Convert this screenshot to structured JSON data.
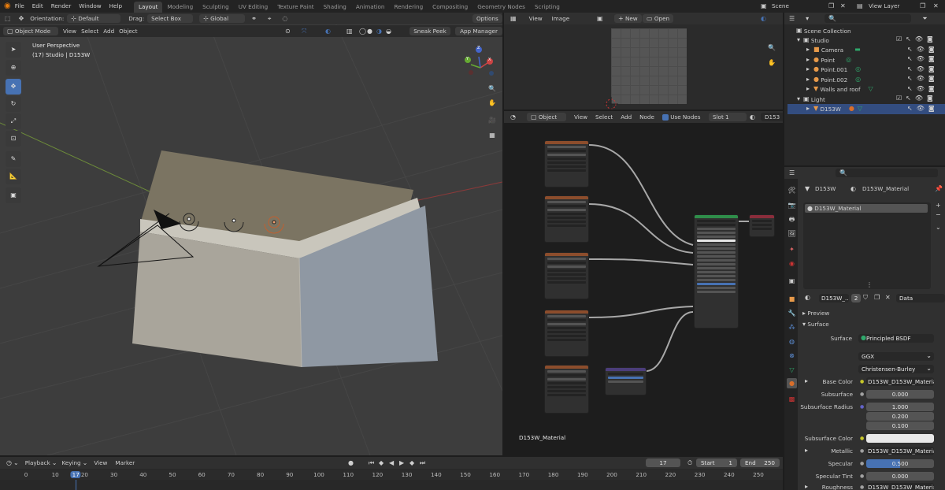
{
  "topbar": {
    "menus": [
      "File",
      "Edit",
      "Render",
      "Window",
      "Help"
    ],
    "workspaces": [
      "Layout",
      "Modeling",
      "Sculpting",
      "UV Editing",
      "Texture Paint",
      "Shading",
      "Animation",
      "Rendering",
      "Compositing",
      "Geometry Nodes",
      "Scripting"
    ],
    "active_workspace": "Layout",
    "scene": "Scene",
    "view_layer": "View Layer"
  },
  "viewport": {
    "toolheader": {
      "orientation_label": "Orientation:",
      "orientation_value": "Default",
      "drag_label": "Drag:",
      "drag_value": "Select Box",
      "transform_value": "Global",
      "options": "Options"
    },
    "header": {
      "mode": "Object Mode",
      "menus": [
        "View",
        "Select",
        "Add",
        "Object"
      ],
      "sneak_peek": "Sneak Peek",
      "app_manager": "App Manager"
    },
    "perspective": "User Perspective",
    "info": "(17) Studio | D153W",
    "gizmo": {
      "x": "X",
      "y": "Y",
      "z": "Z"
    }
  },
  "image_editor": {
    "menus": [
      "View",
      "Image"
    ],
    "new": "New",
    "open": "Open"
  },
  "node_editor": {
    "object": "Object",
    "menus": [
      "View",
      "Select",
      "Add",
      "Node"
    ],
    "use_nodes": "Use Nodes",
    "slot": "Slot 1",
    "material_short": "D153",
    "material_label": "D153W_Material"
  },
  "outliner": {
    "search_placeholder": "",
    "rows": [
      {
        "label": "Scene Collection",
        "indent": 0
      },
      {
        "label": "Studio",
        "indent": 1
      },
      {
        "label": "Camera",
        "indent": 2
      },
      {
        "label": "Point",
        "indent": 2
      },
      {
        "label": "Point.001",
        "indent": 2
      },
      {
        "label": "Point.002",
        "indent": 2
      },
      {
        "label": "Walls and roof",
        "indent": 2
      },
      {
        "label": "Light",
        "indent": 1
      },
      {
        "label": "D153W",
        "indent": 2
      }
    ]
  },
  "properties": {
    "object_name": "D153W",
    "material_name": "D153W_Material",
    "slot_item": "D153W_Material",
    "datablock": "D153W_...",
    "users": "2",
    "link": "Data",
    "panels": {
      "preview": "Preview",
      "surface": "Surface"
    },
    "surface_label": "Surface",
    "surface_value": "Principled BSDF",
    "distribution": "GGX",
    "subsurface_method": "Christensen-Burley",
    "fields": [
      {
        "label": "Base Color",
        "value": "D153W_D153W_Materia..."
      },
      {
        "label": "Subsurface",
        "value": "0.000"
      },
      {
        "label": "Subsurface Radius",
        "value": "1.000"
      },
      {
        "label": "",
        "value": "0.200"
      },
      {
        "label": "",
        "value": "0.100"
      },
      {
        "label": "Subsurface Color",
        "value": ""
      },
      {
        "label": "Metallic",
        "value": "D153W_D153W_Materia..."
      },
      {
        "label": "Specular",
        "value": "0.500"
      },
      {
        "label": "Specular Tint",
        "value": "0.000"
      },
      {
        "label": "Roughness",
        "value": "D153W_D153W_Materia..."
      }
    ]
  },
  "timeline": {
    "menus": [
      "Playback",
      "Keying",
      "View",
      "Marker"
    ],
    "current_frame": "17",
    "start_label": "Start",
    "start": "1",
    "end_label": "End",
    "end": "250",
    "ruler": [
      "0",
      "10",
      "17",
      "20",
      "30",
      "40",
      "50",
      "60",
      "70",
      "80",
      "90",
      "100",
      "110",
      "120",
      "130",
      "140",
      "150",
      "160",
      "170",
      "180",
      "190",
      "200",
      "210",
      "220",
      "230",
      "240",
      "250"
    ]
  },
  "colors": {
    "accent": "#4772b3",
    "header": "#303030",
    "viewport_bg": "#3d3d3d",
    "node_bg": "#1d1d1d"
  }
}
